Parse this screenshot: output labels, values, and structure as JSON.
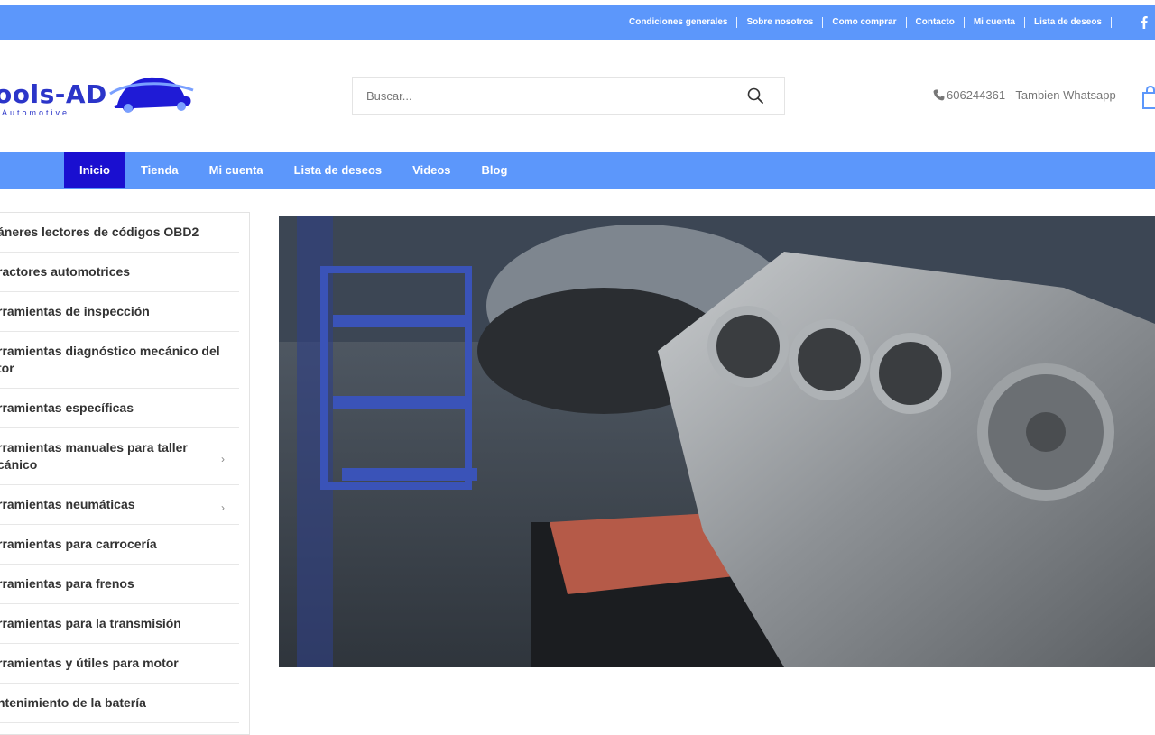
{
  "topbar": {
    "links": [
      "Condiciones generales",
      "Sobre nosotros",
      "Como comprar",
      "Contacto",
      "Mi cuenta",
      "Lista de deseos"
    ]
  },
  "logo": {
    "text": "ools-AD",
    "subtitle": "Automotive"
  },
  "search": {
    "placeholder": "Buscar..."
  },
  "phone": {
    "text": "606244361 - Tambien Whatsapp"
  },
  "nav": {
    "items": [
      "Inicio",
      "Tienda",
      "Mi cuenta",
      "Lista de deseos",
      "Videos",
      "Blog"
    ],
    "active": "Inicio"
  },
  "sidebar": {
    "items": [
      "áneres lectores de códigos OBD2",
      "ractores automotrices",
      "rramientas de inspección",
      "rramientas diagnóstico mecánico del tor",
      "rramientas específicas",
      "rramientas manuales para taller cánico",
      "rramientas neumáticas",
      "rramientas para carrocería",
      "rramientas para frenos",
      "rramientas para la transmisión",
      "rramientas y útiles para motor",
      "ntenimiento de la batería"
    ]
  },
  "colors": {
    "brand_blue": "#5c97fb",
    "active_nav": "#1a0fd0",
    "logo_blue": "#2b35c9"
  },
  "icons": {
    "search": "search-icon",
    "phone": "phone-icon",
    "cart": "shopping-bag-icon",
    "facebook": "facebook-icon",
    "submenu": "chevron-right-icon"
  }
}
